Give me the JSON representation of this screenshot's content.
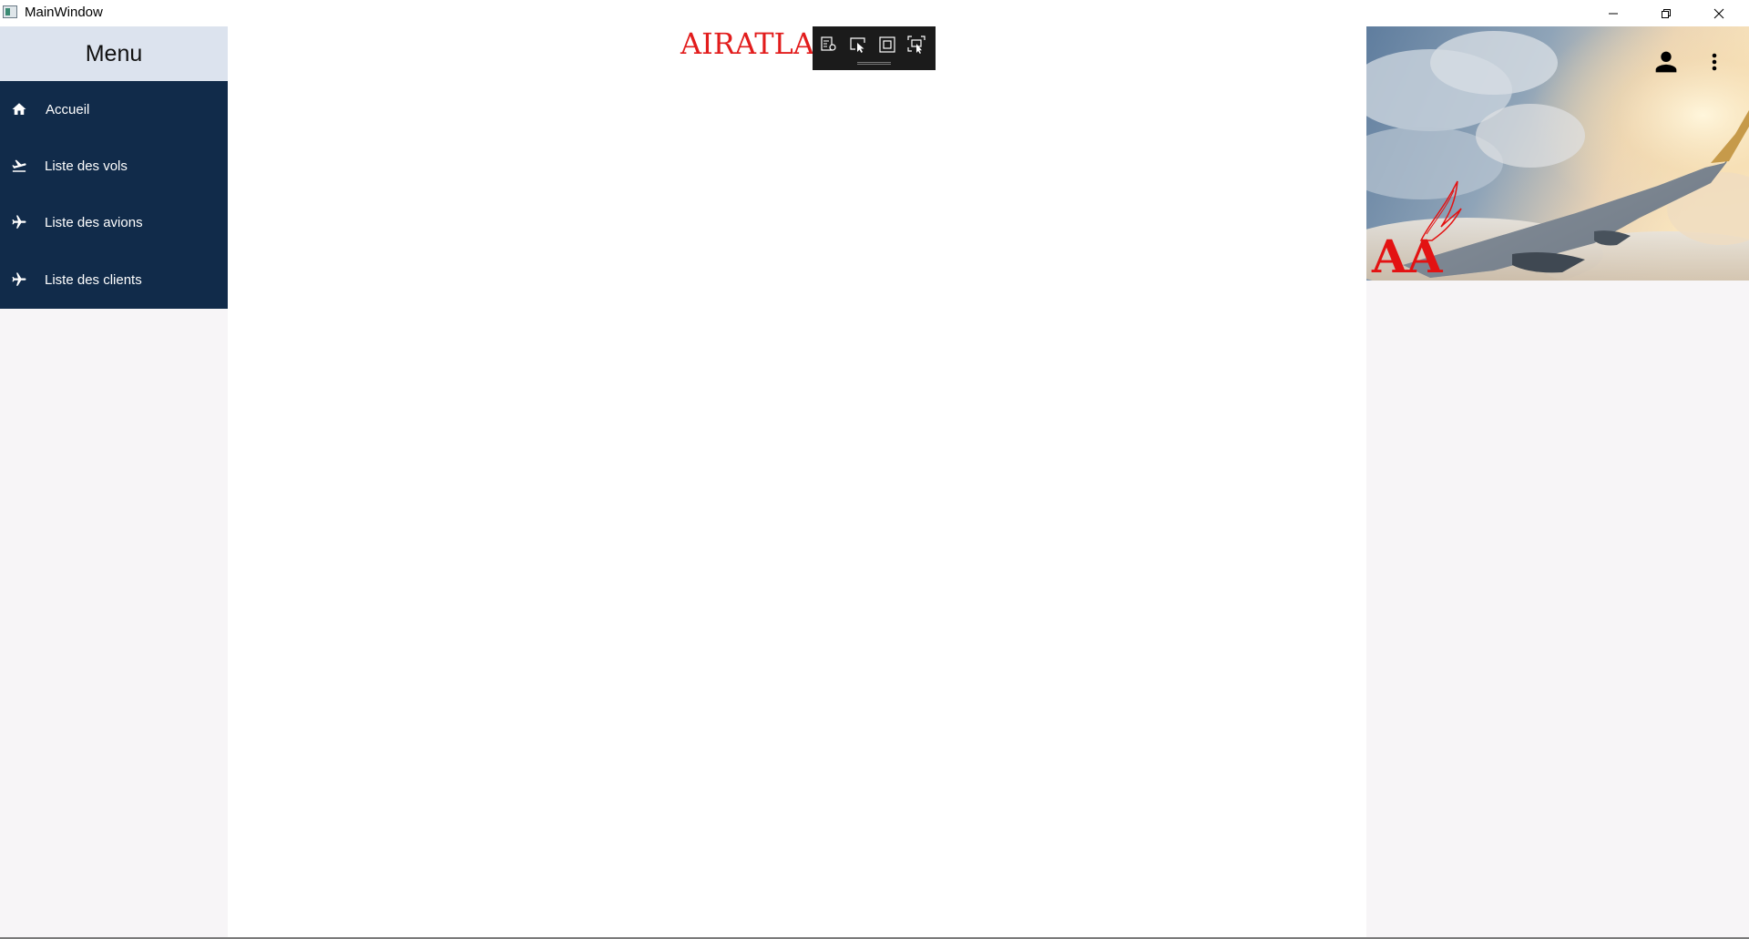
{
  "window": {
    "title": "MainWindow",
    "icon": "app-window-icon",
    "controls": [
      "minimize-icon",
      "restore-icon",
      "close-icon"
    ]
  },
  "sidebar": {
    "header": "Menu",
    "colors": {
      "header_bg": "#dce3ee",
      "nav_bg": "#112b4a",
      "panel_bg": "#f7f5f7"
    },
    "items": [
      {
        "label": "Accueil",
        "icon": "home-icon"
      },
      {
        "label": "Liste des vols",
        "icon": "flight-takeoff-icon"
      },
      {
        "label": "Liste des avions",
        "icon": "airplane-icon"
      },
      {
        "label": "Liste des clients",
        "icon": "airplane-icon"
      }
    ]
  },
  "main": {
    "brand_title": "AIRATLA",
    "brand_color": "#e21c1c"
  },
  "debug_toolbar": {
    "buttons": [
      "live-visual-tree-icon",
      "select-element-icon",
      "display-layout-adorners-icon",
      "track-focused-element-icon"
    ]
  },
  "right_panel": {
    "hero_image": "airplane-wing-over-clouds",
    "logo_text": "AA",
    "account_icon": "account-icon",
    "more_icon": "more-vertical-icon"
  }
}
